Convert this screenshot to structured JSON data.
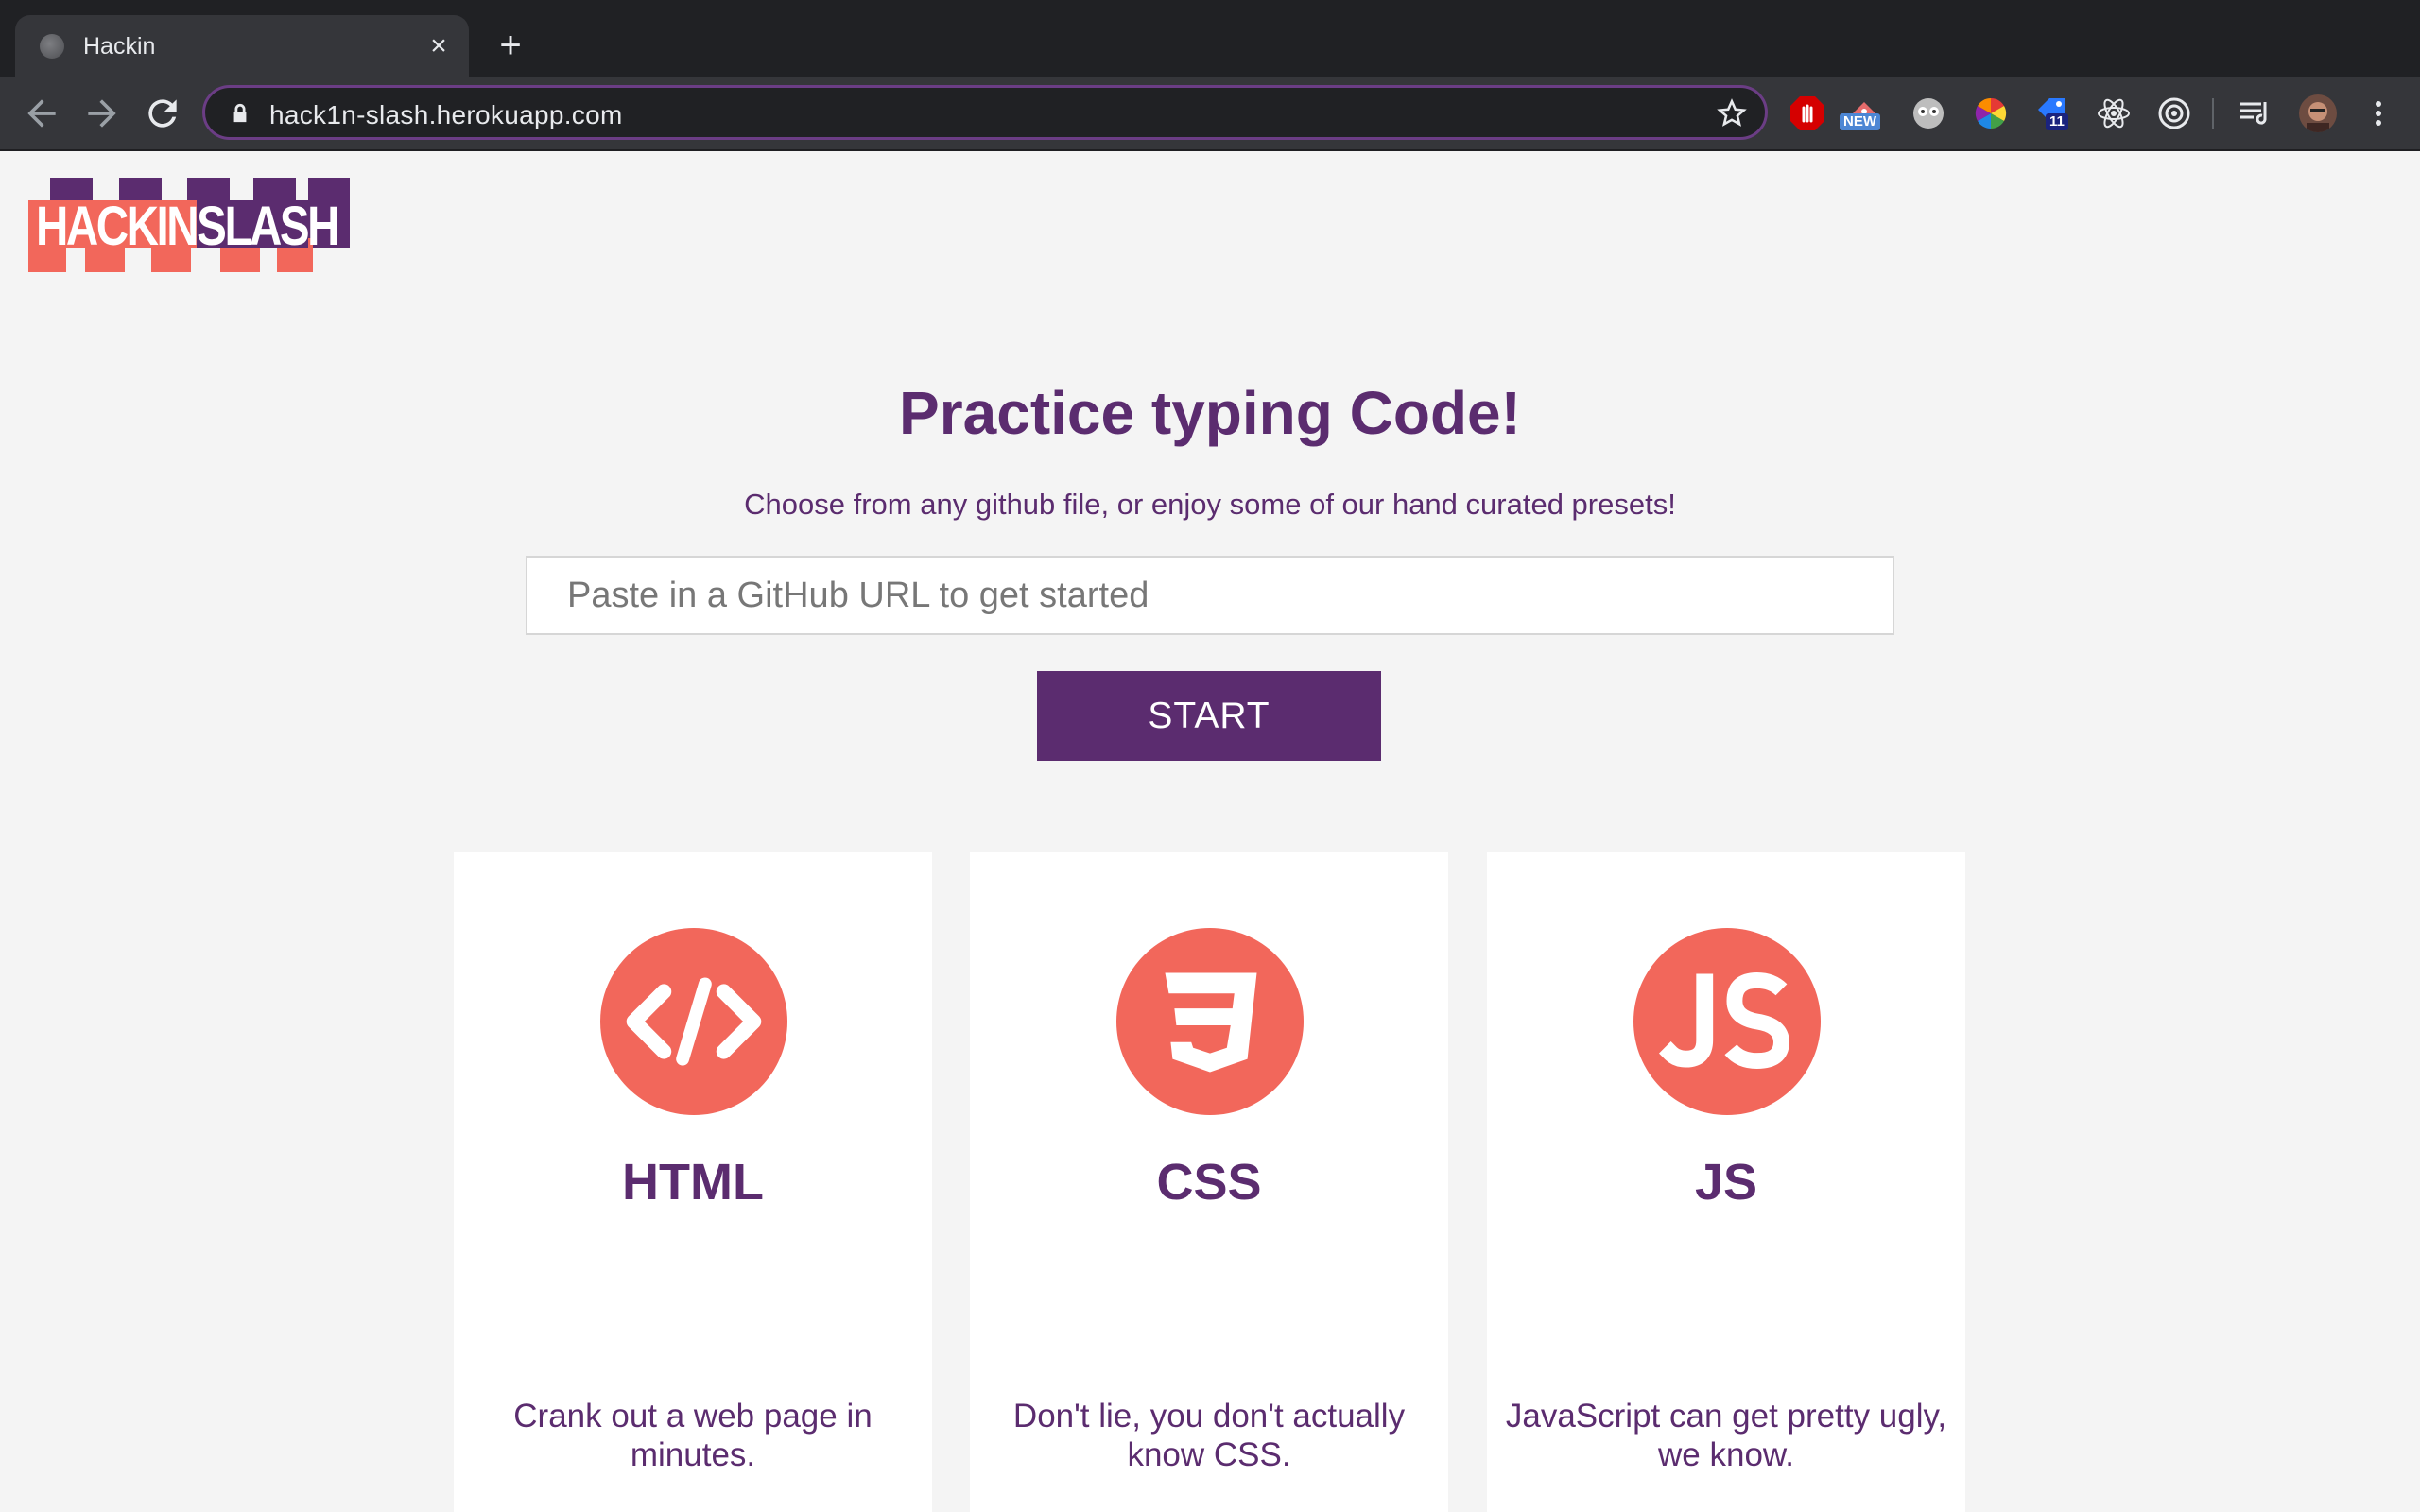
{
  "browser": {
    "tab_title": "Hackin",
    "close_glyph": "×",
    "newtab_glyph": "+",
    "url": "hack1n-slash.herokuapp.com",
    "extensions": {
      "new_badge": "NEW",
      "count_badge": "11"
    }
  },
  "logo": {
    "text": "HACKINSLASH"
  },
  "hero": {
    "title": "Practice typing Code!",
    "subtitle": "Choose from any github file, or enjoy some of our hand curated presets!",
    "input_placeholder": "Paste in a GitHub URL to get started",
    "start_label": "START"
  },
  "cards": [
    {
      "icon": "html-code-icon",
      "title": "HTML",
      "description": "Crank out a web page in minutes."
    },
    {
      "icon": "css3-icon",
      "title": "CSS",
      "description": "Don't lie, you don't actually know CSS."
    },
    {
      "icon": "js-icon",
      "title": "JS",
      "description": "JavaScript can get pretty ugly, we know."
    }
  ],
  "colors": {
    "brand_purple": "#5b2c6f",
    "accent_coral": "#f2675b",
    "background": "#f4f4f4"
  }
}
